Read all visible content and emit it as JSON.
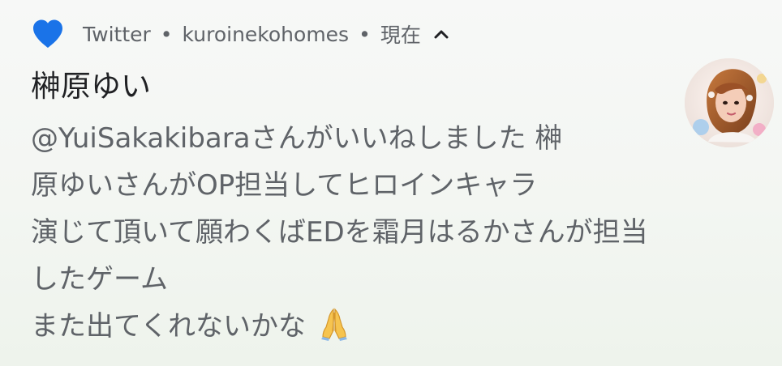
{
  "notification": {
    "app_name": "Twitter",
    "separator1": "•",
    "account": "kuroinekohomes",
    "separator2": "•",
    "time": "現在",
    "title": "榊原ゆい",
    "message_lines": [
      "@YuiSakakibaraさんがいいねしました 榊",
      "原ゆいさんがOP担当してヒロインキャラ",
      "演じて頂いて願わくばEDを霜月はるかさんが担当",
      "したゲーム",
      "また出てくれないかな"
    ],
    "emoji_icon": "folded-hands-icon",
    "app_icon": "heart-icon",
    "expand_icon": "chevron-up-icon",
    "accent_color": "#1a73e8",
    "text_color": "#5f6368",
    "title_color": "#202124"
  }
}
